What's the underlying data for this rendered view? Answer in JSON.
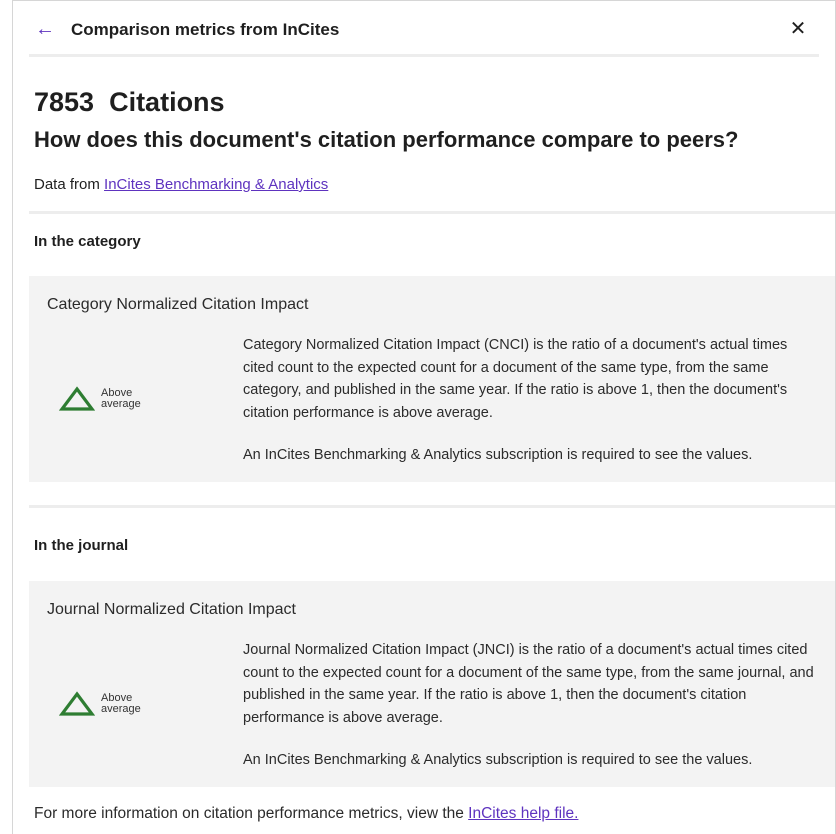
{
  "header": {
    "title": "Comparison metrics from InCites"
  },
  "summary": {
    "headline": "7853  Citations",
    "question": "How does this document's citation performance compare to peers?",
    "data_from_prefix": "Data from ",
    "data_from_link": "InCites Benchmarking & Analytics"
  },
  "category_section": {
    "heading": "In the category",
    "metric_title": "Category Normalized Citation Impact",
    "badge": "Above average",
    "description": "Category Normalized Citation Impact (CNCI) is the ratio of a document's actual times cited count to the expected count for a document of the same type, from the same category, and published in the same year. If the ratio is above 1, then the document's citation performance is above average.",
    "note": "An InCites Benchmarking & Analytics subscription is required to see the values."
  },
  "journal_section": {
    "heading": "In the journal",
    "metric_title": "Journal Normalized Citation Impact",
    "badge": "Above average",
    "description": "Journal Normalized Citation Impact (JNCI) is the ratio of a document's actual times cited count to the expected count for a document of the same type, from the same journal, and published in the same year. If the ratio is above 1, then the document's citation performance is above average.",
    "note": "An InCites Benchmarking & Analytics subscription is required to see the values."
  },
  "footer": {
    "prefix": "For more information on citation performance metrics, view the ",
    "link": "InCites help file."
  },
  "colors": {
    "accent": "#5e33bf",
    "above_average": "#2e7d32",
    "card_bg": "#f3f3f3"
  },
  "icons": {
    "back": "arrow-left-icon",
    "close": "close-icon",
    "indicator": "triangle-up-icon"
  }
}
